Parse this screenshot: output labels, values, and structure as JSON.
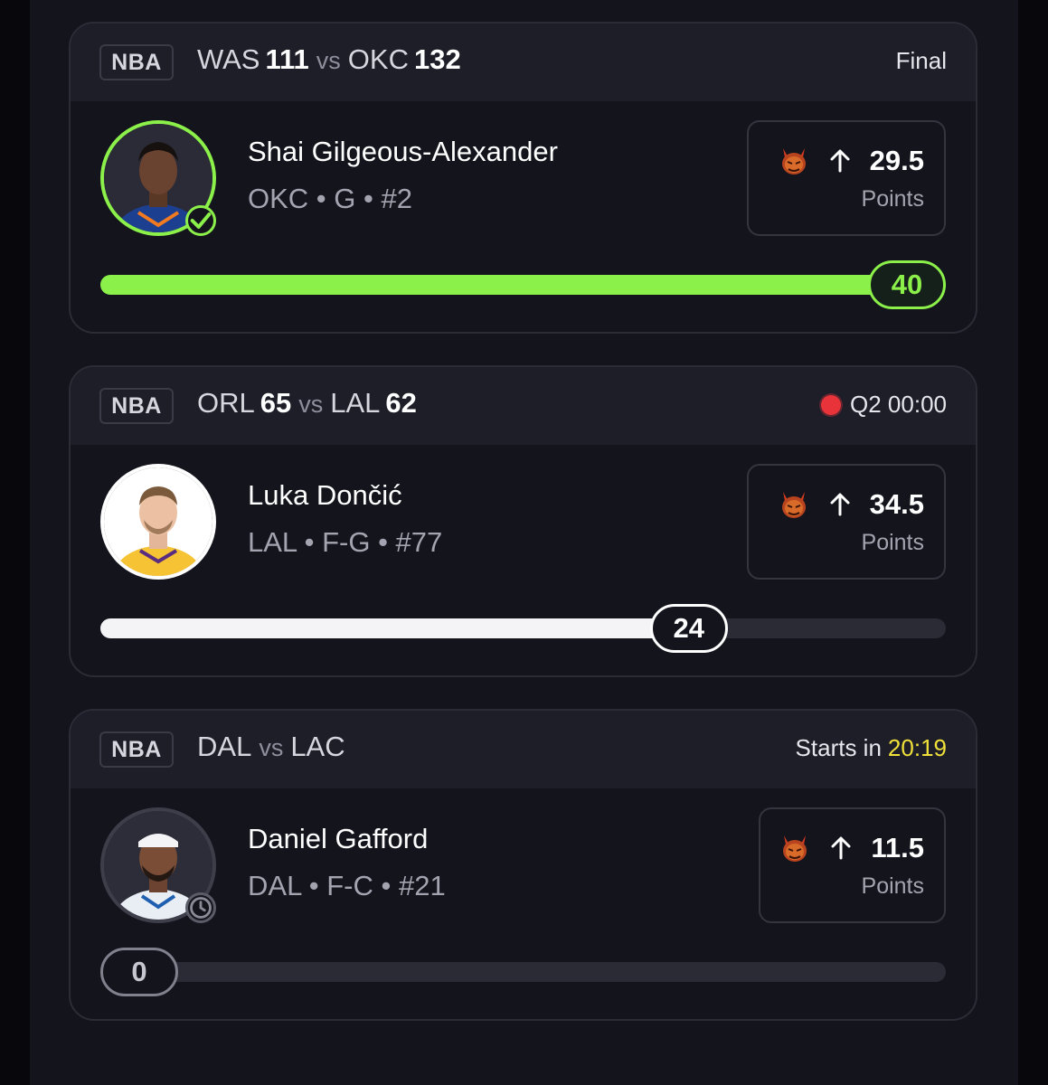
{
  "colors": {
    "accent_green": "#8cf04a",
    "live_red": "#e8333b",
    "countdown_yellow": "#f0e03a",
    "background": "#14141d"
  },
  "cards": [
    {
      "league": "NBA",
      "away_team": "WAS",
      "away_score": "111",
      "vs": "vs",
      "home_team": "OKC",
      "home_score": "132",
      "status": "Final",
      "player": {
        "name": "Shai Gilgeous-Alexander",
        "meta": "OKC • G • #2",
        "avatar_state": "check-icon"
      },
      "line": {
        "value": "29.5",
        "stat": "Points",
        "direction_icon": "arrow-up-icon",
        "badge_icon": "devil-icon"
      },
      "progress": {
        "current": "40",
        "fraction": 1.0
      }
    },
    {
      "league": "NBA",
      "away_team": "ORL",
      "away_score": "65",
      "vs": "vs",
      "home_team": "LAL",
      "home_score": "62",
      "status": "Q2 00:00",
      "live_icon": "live-dot-icon",
      "player": {
        "name": "Luka Dončić",
        "meta": "LAL • F-G • #77",
        "avatar_state": "none"
      },
      "line": {
        "value": "34.5",
        "stat": "Points",
        "direction_icon": "arrow-up-icon",
        "badge_icon": "devil-icon"
      },
      "progress": {
        "current": "24",
        "fraction": 0.696
      }
    },
    {
      "league": "NBA",
      "away_team": "DAL",
      "away_score": "",
      "vs": "vs",
      "home_team": "LAC",
      "home_score": "",
      "status_prefix": "Starts in",
      "status_time": "20:19",
      "player": {
        "name": "Daniel Gafford",
        "meta": "DAL • F-C • #21",
        "avatar_state": "clock-icon"
      },
      "line": {
        "value": "11.5",
        "stat": "Points",
        "direction_icon": "arrow-up-icon",
        "badge_icon": "devil-icon"
      },
      "progress": {
        "current": "0",
        "fraction": 0.0
      }
    }
  ]
}
